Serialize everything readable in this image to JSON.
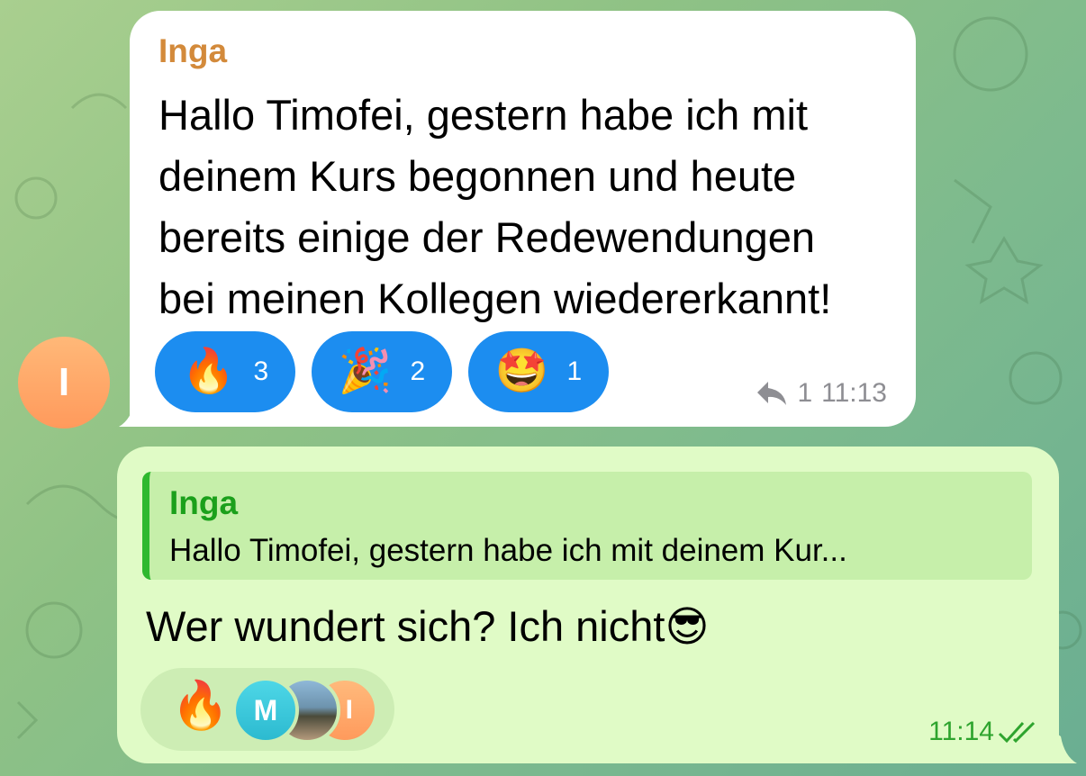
{
  "incoming": {
    "avatar_letter": "I",
    "sender": "Inga",
    "lines": [
      "Hallo Timofei, gestern habe ich mit",
      "deinem Kurs begonnen und heute",
      "bereits einige der Redewendungen",
      "bei meinen Kollegen wiedererkannt!"
    ],
    "reactions": [
      {
        "emoji": "🔥",
        "count": "3"
      },
      {
        "emoji": "🎉",
        "count": "2"
      },
      {
        "emoji": "🤩",
        "count": "1"
      }
    ],
    "reply_count": "1",
    "time": "11:13"
  },
  "outgoing": {
    "reply_name": "Inga",
    "reply_preview": "Hallo Timofei, gestern habe ich mit deinem Kur...",
    "text": "Wer wundert sich? Ich nicht😎",
    "reaction_emoji": "🔥",
    "reactor_m": "M",
    "reactor_i": "I",
    "time": "11:14"
  },
  "colors": {
    "sender_in": "#d38a3b",
    "reply_accent": "#2eb82e",
    "reaction_chip": "#1c8df0",
    "outgoing_bubble": "#e0fbc6"
  }
}
